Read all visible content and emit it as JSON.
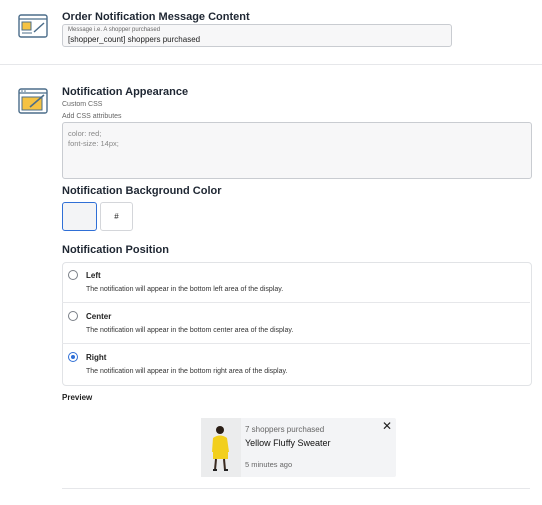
{
  "message_section": {
    "title": "Order Notification Message Content",
    "field_label": "Message i.e. A shopper purchased",
    "field_value": "[shopper_count] shoppers purchased"
  },
  "appearance_section": {
    "title": "Notification Appearance",
    "custom_css_label": "Custom CSS",
    "add_css_label": "Add CSS attributes",
    "css_value": "color: red;\nfont-size: 14px;"
  },
  "background_color": {
    "title": "Notification Background Color",
    "hex_value": "#",
    "swatch_color": "#f3f4f6"
  },
  "position": {
    "title": "Notification Position",
    "options": [
      {
        "label": "Left",
        "description": "The notification will appear in the bottom left area of the display.",
        "selected": false
      },
      {
        "label": "Center",
        "description": "The notification will appear in the bottom center area of the display.",
        "selected": false
      },
      {
        "label": "Right",
        "description": "The notification will appear in the bottom right area of the display.",
        "selected": true
      }
    ]
  },
  "preview": {
    "title": "Preview",
    "count_text": "7 shoppers purchased",
    "product_name": "Yellow Fluffy Sweater",
    "time_text": "5 minutes ago",
    "close_icon": "close-icon",
    "image": "product-thumbnail"
  },
  "colors": {
    "accent": "#2f6fd6",
    "icon_yellow": "#f5c242",
    "card_bg": "#f3f4f6"
  }
}
